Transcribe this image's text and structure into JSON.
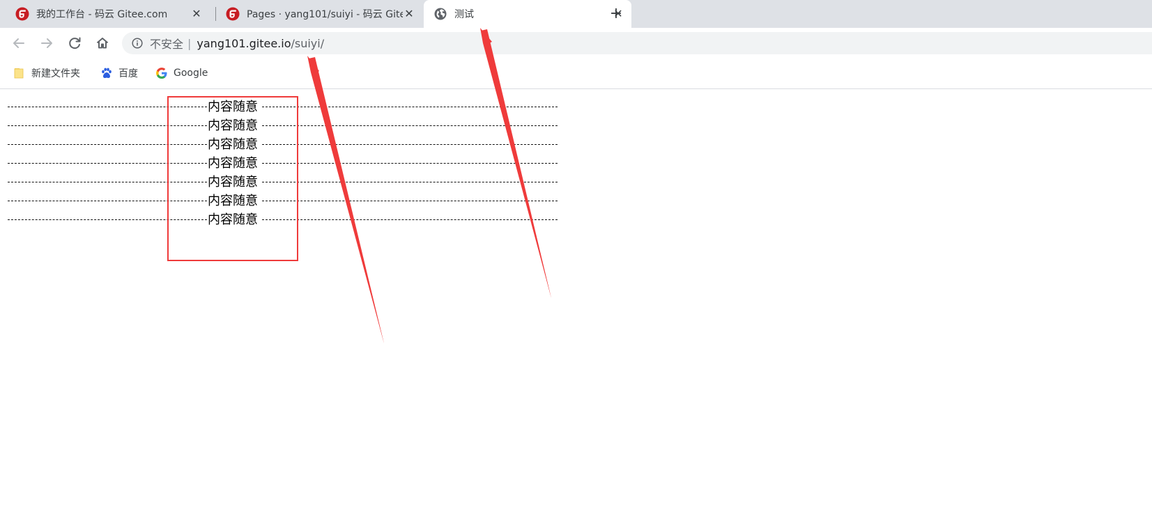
{
  "browser": {
    "tabs": [
      {
        "title": "我的工作台 - 码云 Gitee.com",
        "icon": "gitee-icon",
        "active": false
      },
      {
        "title": "Pages · yang101/suiyi - 码云 Gitee",
        "icon": "gitee-icon",
        "active": false
      },
      {
        "title": "测试",
        "icon": "globe-icon",
        "active": true
      }
    ],
    "close_glyph": "✕",
    "new_tab_glyph": "+",
    "address": {
      "security_label": "不安全",
      "separator": "|",
      "host": "yang101.gitee.io",
      "path": "/suiyi/"
    },
    "bookmarks": [
      {
        "label": "新建文件夹",
        "icon": "folder-icon"
      },
      {
        "label": "百度",
        "icon": "baidu-icon"
      },
      {
        "label": "Google",
        "icon": "google-icon"
      }
    ]
  },
  "page": {
    "lines": [
      "内容随意",
      "内容随意",
      "内容随意",
      "内容随意",
      "内容随意",
      "内容随意",
      "内容随意"
    ]
  },
  "colors": {
    "annotation_red": "#ef3b3b",
    "tabstrip_bg": "#dee1e6",
    "gitee_red": "#c71d23"
  }
}
